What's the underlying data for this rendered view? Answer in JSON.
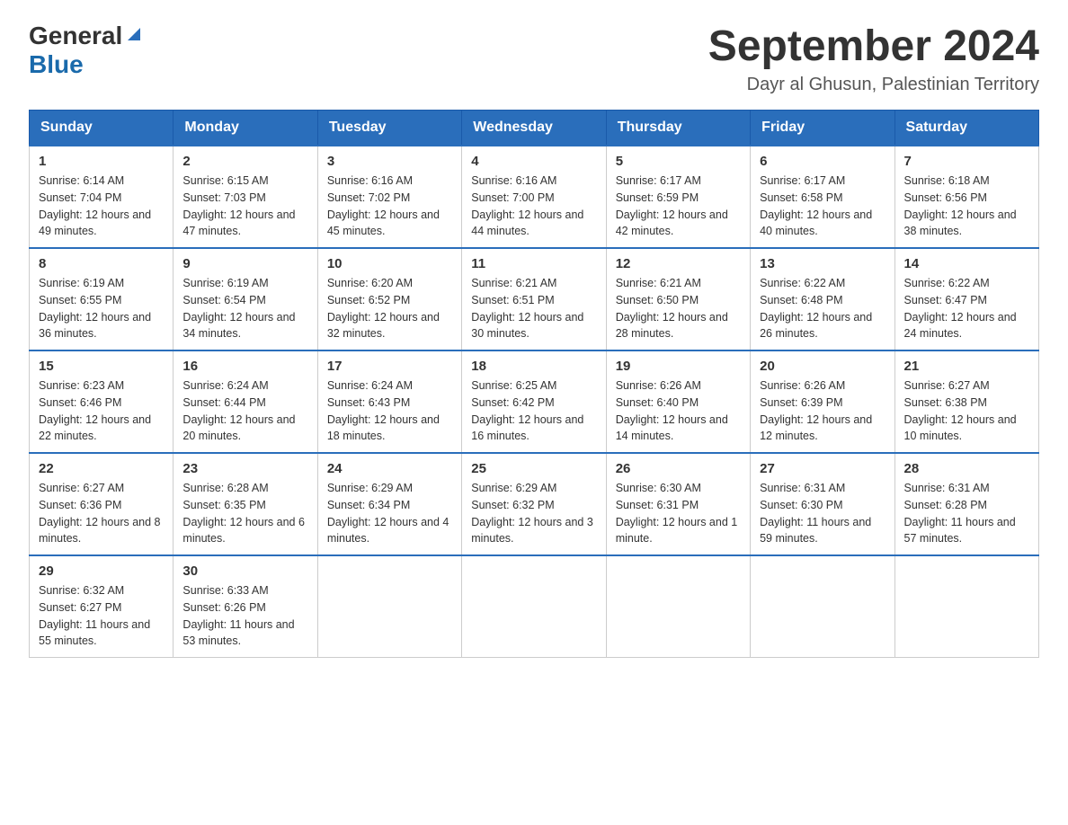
{
  "logo": {
    "general": "General",
    "blue": "Blue"
  },
  "title": "September 2024",
  "subtitle": "Dayr al Ghusun, Palestinian Territory",
  "days_of_week": [
    "Sunday",
    "Monday",
    "Tuesday",
    "Wednesday",
    "Thursday",
    "Friday",
    "Saturday"
  ],
  "weeks": [
    [
      {
        "day": "1",
        "sunrise": "Sunrise: 6:14 AM",
        "sunset": "Sunset: 7:04 PM",
        "daylight": "Daylight: 12 hours and 49 minutes."
      },
      {
        "day": "2",
        "sunrise": "Sunrise: 6:15 AM",
        "sunset": "Sunset: 7:03 PM",
        "daylight": "Daylight: 12 hours and 47 minutes."
      },
      {
        "day": "3",
        "sunrise": "Sunrise: 6:16 AM",
        "sunset": "Sunset: 7:02 PM",
        "daylight": "Daylight: 12 hours and 45 minutes."
      },
      {
        "day": "4",
        "sunrise": "Sunrise: 6:16 AM",
        "sunset": "Sunset: 7:00 PM",
        "daylight": "Daylight: 12 hours and 44 minutes."
      },
      {
        "day": "5",
        "sunrise": "Sunrise: 6:17 AM",
        "sunset": "Sunset: 6:59 PM",
        "daylight": "Daylight: 12 hours and 42 minutes."
      },
      {
        "day": "6",
        "sunrise": "Sunrise: 6:17 AM",
        "sunset": "Sunset: 6:58 PM",
        "daylight": "Daylight: 12 hours and 40 minutes."
      },
      {
        "day": "7",
        "sunrise": "Sunrise: 6:18 AM",
        "sunset": "Sunset: 6:56 PM",
        "daylight": "Daylight: 12 hours and 38 minutes."
      }
    ],
    [
      {
        "day": "8",
        "sunrise": "Sunrise: 6:19 AM",
        "sunset": "Sunset: 6:55 PM",
        "daylight": "Daylight: 12 hours and 36 minutes."
      },
      {
        "day": "9",
        "sunrise": "Sunrise: 6:19 AM",
        "sunset": "Sunset: 6:54 PM",
        "daylight": "Daylight: 12 hours and 34 minutes."
      },
      {
        "day": "10",
        "sunrise": "Sunrise: 6:20 AM",
        "sunset": "Sunset: 6:52 PM",
        "daylight": "Daylight: 12 hours and 32 minutes."
      },
      {
        "day": "11",
        "sunrise": "Sunrise: 6:21 AM",
        "sunset": "Sunset: 6:51 PM",
        "daylight": "Daylight: 12 hours and 30 minutes."
      },
      {
        "day": "12",
        "sunrise": "Sunrise: 6:21 AM",
        "sunset": "Sunset: 6:50 PM",
        "daylight": "Daylight: 12 hours and 28 minutes."
      },
      {
        "day": "13",
        "sunrise": "Sunrise: 6:22 AM",
        "sunset": "Sunset: 6:48 PM",
        "daylight": "Daylight: 12 hours and 26 minutes."
      },
      {
        "day": "14",
        "sunrise": "Sunrise: 6:22 AM",
        "sunset": "Sunset: 6:47 PM",
        "daylight": "Daylight: 12 hours and 24 minutes."
      }
    ],
    [
      {
        "day": "15",
        "sunrise": "Sunrise: 6:23 AM",
        "sunset": "Sunset: 6:46 PM",
        "daylight": "Daylight: 12 hours and 22 minutes."
      },
      {
        "day": "16",
        "sunrise": "Sunrise: 6:24 AM",
        "sunset": "Sunset: 6:44 PM",
        "daylight": "Daylight: 12 hours and 20 minutes."
      },
      {
        "day": "17",
        "sunrise": "Sunrise: 6:24 AM",
        "sunset": "Sunset: 6:43 PM",
        "daylight": "Daylight: 12 hours and 18 minutes."
      },
      {
        "day": "18",
        "sunrise": "Sunrise: 6:25 AM",
        "sunset": "Sunset: 6:42 PM",
        "daylight": "Daylight: 12 hours and 16 minutes."
      },
      {
        "day": "19",
        "sunrise": "Sunrise: 6:26 AM",
        "sunset": "Sunset: 6:40 PM",
        "daylight": "Daylight: 12 hours and 14 minutes."
      },
      {
        "day": "20",
        "sunrise": "Sunrise: 6:26 AM",
        "sunset": "Sunset: 6:39 PM",
        "daylight": "Daylight: 12 hours and 12 minutes."
      },
      {
        "day": "21",
        "sunrise": "Sunrise: 6:27 AM",
        "sunset": "Sunset: 6:38 PM",
        "daylight": "Daylight: 12 hours and 10 minutes."
      }
    ],
    [
      {
        "day": "22",
        "sunrise": "Sunrise: 6:27 AM",
        "sunset": "Sunset: 6:36 PM",
        "daylight": "Daylight: 12 hours and 8 minutes."
      },
      {
        "day": "23",
        "sunrise": "Sunrise: 6:28 AM",
        "sunset": "Sunset: 6:35 PM",
        "daylight": "Daylight: 12 hours and 6 minutes."
      },
      {
        "day": "24",
        "sunrise": "Sunrise: 6:29 AM",
        "sunset": "Sunset: 6:34 PM",
        "daylight": "Daylight: 12 hours and 4 minutes."
      },
      {
        "day": "25",
        "sunrise": "Sunrise: 6:29 AM",
        "sunset": "Sunset: 6:32 PM",
        "daylight": "Daylight: 12 hours and 3 minutes."
      },
      {
        "day": "26",
        "sunrise": "Sunrise: 6:30 AM",
        "sunset": "Sunset: 6:31 PM",
        "daylight": "Daylight: 12 hours and 1 minute."
      },
      {
        "day": "27",
        "sunrise": "Sunrise: 6:31 AM",
        "sunset": "Sunset: 6:30 PM",
        "daylight": "Daylight: 11 hours and 59 minutes."
      },
      {
        "day": "28",
        "sunrise": "Sunrise: 6:31 AM",
        "sunset": "Sunset: 6:28 PM",
        "daylight": "Daylight: 11 hours and 57 minutes."
      }
    ],
    [
      {
        "day": "29",
        "sunrise": "Sunrise: 6:32 AM",
        "sunset": "Sunset: 6:27 PM",
        "daylight": "Daylight: 11 hours and 55 minutes."
      },
      {
        "day": "30",
        "sunrise": "Sunrise: 6:33 AM",
        "sunset": "Sunset: 6:26 PM",
        "daylight": "Daylight: 11 hours and 53 minutes."
      },
      null,
      null,
      null,
      null,
      null
    ]
  ]
}
